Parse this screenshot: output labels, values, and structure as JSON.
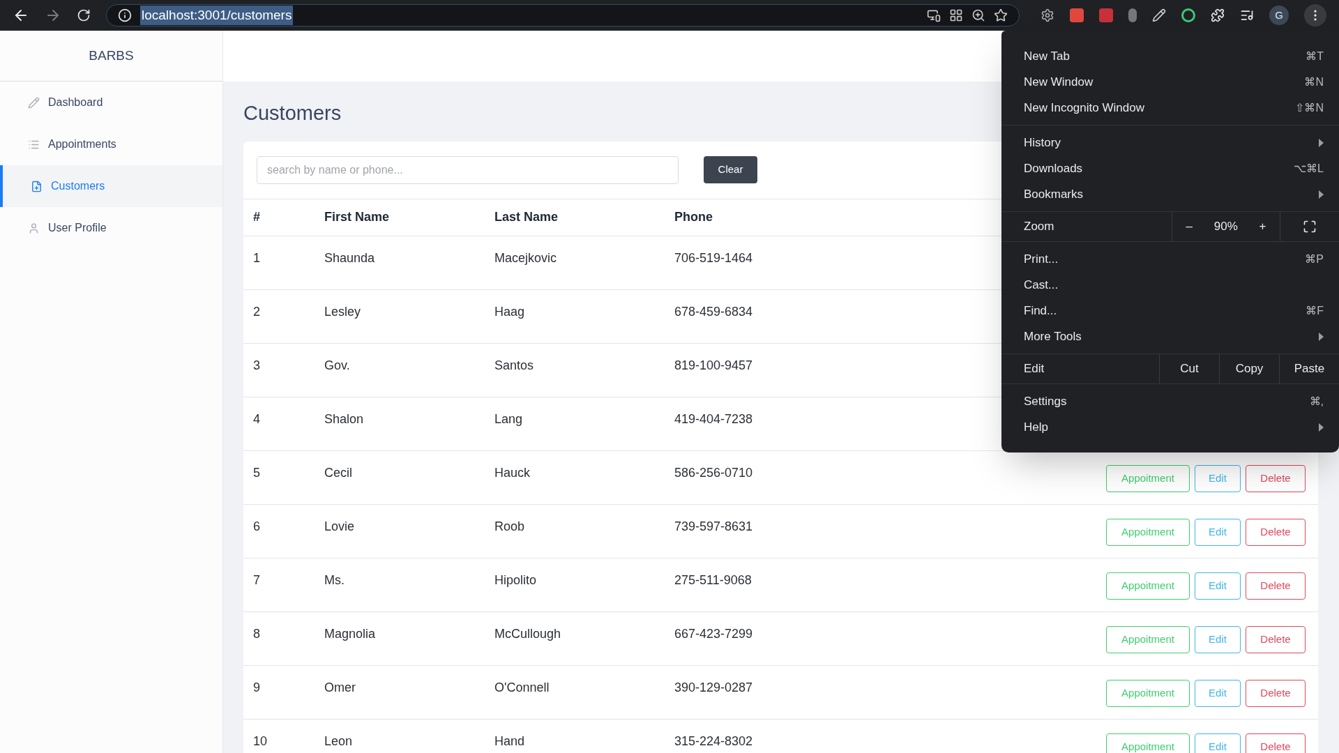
{
  "browser": {
    "address": {
      "url": "localhost:3001/customers",
      "selected": true
    },
    "avatar": "G"
  },
  "sidebar": {
    "brand": "BARBS",
    "items": [
      {
        "label": "Dashboard",
        "selected": false
      },
      {
        "label": "Appointments",
        "selected": false
      },
      {
        "label": "Customers",
        "selected": true
      },
      {
        "label": "User Profile",
        "selected": false
      }
    ]
  },
  "page": {
    "title": "Customers",
    "search": {
      "placeholder": "search by name or phone..."
    },
    "clear_button": "Clear"
  },
  "table": {
    "columns": [
      "#",
      "First Name",
      "Last Name",
      "Phone"
    ],
    "rows": [
      {
        "cells": [
          "1",
          "Shaunda",
          "Macejkovic",
          "706-519-1464"
        ]
      },
      {
        "cells": [
          "2",
          "Lesley",
          "Haag",
          "678-459-6834"
        ]
      },
      {
        "cells": [
          "3",
          "Gov.",
          "Santos",
          "819-100-9457"
        ]
      },
      {
        "cells": [
          "4",
          "Shalon",
          "Lang",
          "419-404-7238"
        ]
      },
      {
        "cells": [
          "5",
          "Cecil",
          "Hauck",
          "586-256-0710"
        ],
        "actions": [
          {
            "kind": "appointment",
            "label": "Appoitment"
          },
          {
            "kind": "edit",
            "label": "Edit"
          },
          {
            "kind": "delete",
            "label": "Delete"
          }
        ]
      },
      {
        "cells": [
          "6",
          "Lovie",
          "Roob",
          "739-597-8631"
        ],
        "actions": [
          {
            "kind": "appointment",
            "label": "Appoitment"
          },
          {
            "kind": "edit",
            "label": "Edit"
          },
          {
            "kind": "delete",
            "label": "Delete"
          }
        ]
      },
      {
        "cells": [
          "7",
          "Ms.",
          "Hipolito",
          "275-511-9068"
        ],
        "actions": [
          {
            "kind": "appointment",
            "label": "Appoitment"
          },
          {
            "kind": "edit",
            "label": "Edit"
          },
          {
            "kind": "delete",
            "label": "Delete"
          }
        ]
      },
      {
        "cells": [
          "8",
          "Magnolia",
          "McCullough",
          "667-423-7299"
        ],
        "actions": [
          {
            "kind": "appointment",
            "label": "Appoitment"
          },
          {
            "kind": "edit",
            "label": "Edit"
          },
          {
            "kind": "delete",
            "label": "Delete"
          }
        ]
      },
      {
        "cells": [
          "9",
          "Omer",
          "O'Connell",
          "390-129-0287"
        ],
        "actions": [
          {
            "kind": "appointment",
            "label": "Appoitment"
          },
          {
            "kind": "edit",
            "label": "Edit"
          },
          {
            "kind": "delete",
            "label": "Delete"
          }
        ]
      },
      {
        "cells": [
          "10",
          "Leon",
          "Hand",
          "315-224-8302"
        ],
        "actions": [
          {
            "kind": "appointment",
            "label": "Appoitment"
          },
          {
            "kind": "edit",
            "label": "Edit"
          },
          {
            "kind": "delete",
            "label": "Delete"
          }
        ]
      }
    ]
  },
  "menu": {
    "groups": [
      [
        {
          "kind": "item",
          "label": "New Tab",
          "shortcut": "⌘T",
          "submenu": false
        },
        {
          "kind": "item",
          "label": "New Window",
          "shortcut": "⌘N",
          "submenu": false
        },
        {
          "kind": "item",
          "label": "New Incognito Window",
          "shortcut": "⇧⌘N",
          "submenu": false
        }
      ],
      [
        {
          "kind": "item",
          "label": "History",
          "submenu": true
        },
        {
          "kind": "item",
          "label": "Downloads",
          "shortcut": "⌥⌘L",
          "submenu": false
        },
        {
          "kind": "item",
          "label": "Bookmarks",
          "submenu": true
        }
      ],
      [
        {
          "kind": "zoom",
          "label": "Zoom",
          "minus": "–",
          "value": "90%",
          "plus": "+"
        }
      ],
      [
        {
          "kind": "item",
          "label": "Print...",
          "shortcut": "⌘P",
          "submenu": false
        },
        {
          "kind": "item",
          "label": "Cast...",
          "submenu": false
        },
        {
          "kind": "item",
          "label": "Find...",
          "shortcut": "⌘F",
          "submenu": false
        },
        {
          "kind": "item",
          "label": "More Tools",
          "submenu": true
        }
      ],
      [
        {
          "kind": "edit",
          "label": "Edit",
          "actions": [
            "Cut",
            "Copy",
            "Paste"
          ]
        }
      ],
      [
        {
          "kind": "item",
          "label": "Settings",
          "shortcut": "⌘,",
          "submenu": false
        },
        {
          "kind": "item",
          "label": "Help",
          "submenu": true
        }
      ]
    ]
  }
}
